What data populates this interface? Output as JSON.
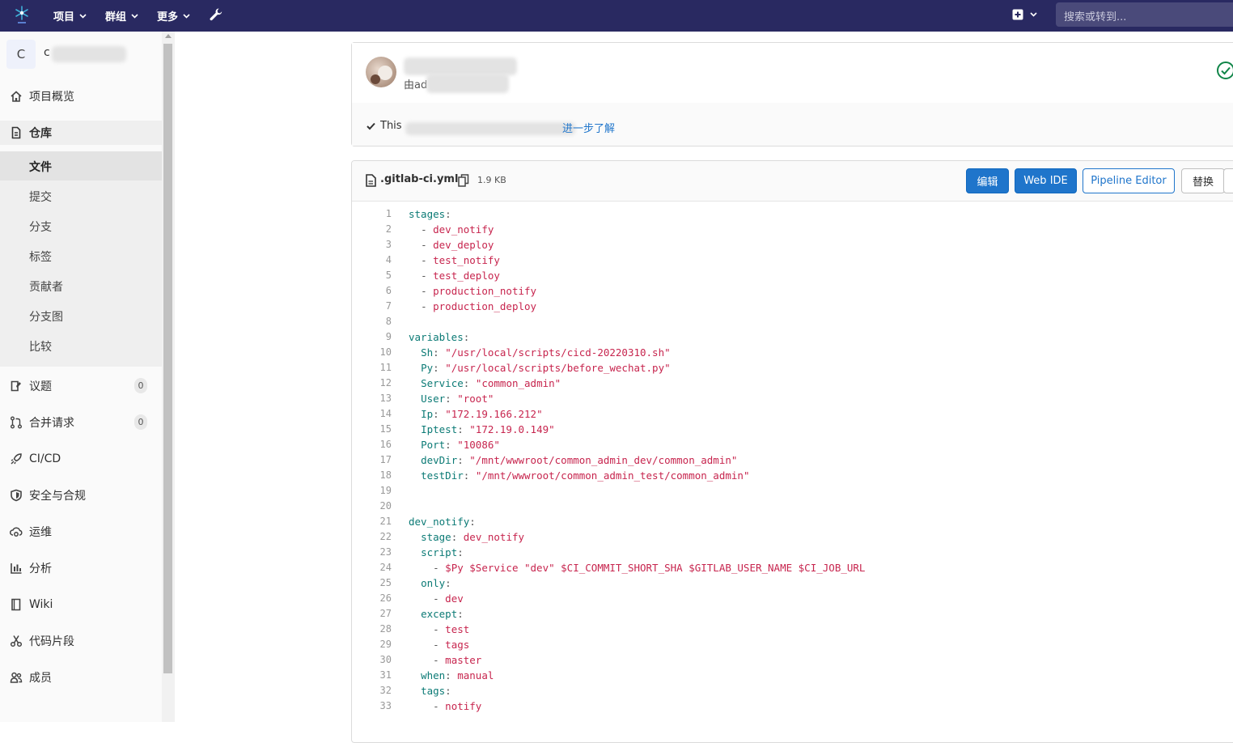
{
  "topbar": {
    "nav": [
      "项目",
      "群组",
      "更多"
    ],
    "search_placeholder": "搜索或转到..."
  },
  "sidebar": {
    "project_initial": "C",
    "project_name": "c",
    "items": [
      {
        "label": "项目概览",
        "icon": "home-icon"
      },
      {
        "label": "仓库",
        "icon": "document-icon"
      },
      {
        "label": "议题",
        "icon": "issues-icon",
        "count": "0"
      },
      {
        "label": "合并请求",
        "icon": "merge-request-icon",
        "count": "0"
      },
      {
        "label": "CI/CD",
        "icon": "rocket-icon"
      },
      {
        "label": "安全与合规",
        "icon": "shield-icon"
      },
      {
        "label": "运维",
        "icon": "cloud-gear-icon"
      },
      {
        "label": "分析",
        "icon": "chart-icon"
      },
      {
        "label": "Wiki",
        "icon": "book-icon"
      },
      {
        "label": "代码片段",
        "icon": "scissors-icon"
      },
      {
        "label": "成员",
        "icon": "users-icon"
      }
    ],
    "repo_sub": [
      "文件",
      "提交",
      "分支",
      "标签",
      "贡献者",
      "分支图",
      "比较"
    ]
  },
  "commit": {
    "author_prefix": "由ad",
    "note_prefix": "This",
    "learn_more": "进一步了解"
  },
  "file": {
    "name": ".gitlab-ci.yml",
    "size": "1.9 KB",
    "buttons": {
      "edit": "编辑",
      "web_ide": "Web IDE",
      "pipeline_editor": "Pipeline Editor",
      "replace": "替换"
    }
  },
  "code_lines": [
    "stages:",
    "  - dev_notify",
    "  - dev_deploy",
    "  - test_notify",
    "  - test_deploy",
    "  - production_notify",
    "  - production_deploy",
    "",
    "variables:",
    "  Sh: \"/usr/local/scripts/cicd-20220310.sh\"",
    "  Py: \"/usr/local/scripts/before_wechat.py\"",
    "  Service: \"common_admin\"",
    "  User: \"root\"",
    "  Ip: \"172.19.166.212\"",
    "  Iptest: \"172.19.0.149\"",
    "  Port: \"10086\"",
    "  devDir: \"/mnt/wwwroot/common_admin_dev/common_admin\"",
    "  testDir: \"/mnt/wwwroot/common_admin_test/common_admin\"",
    "",
    "",
    "dev_notify:",
    "  stage: dev_notify",
    "  script:",
    "    - $Py $Service \"dev\" $CI_COMMIT_SHORT_SHA $GITLAB_USER_NAME $CI_JOB_URL",
    "  only:",
    "    - dev",
    "  except:",
    "    - test",
    "    - tags",
    "    - master",
    "  when: manual",
    "  tags:",
    "    - notify"
  ]
}
